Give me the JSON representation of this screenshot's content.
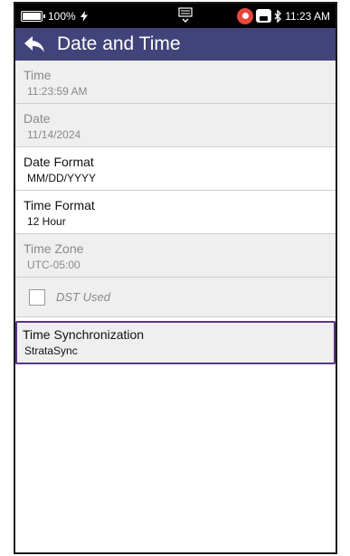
{
  "status_bar": {
    "battery_percent": "100%",
    "time": "11:23 AM",
    "icons": [
      "battery-icon",
      "charging-icon",
      "keyboard-icon",
      "location-pin-icon",
      "cloud-icon",
      "bluetooth-icon"
    ]
  },
  "header": {
    "title": "Date and Time",
    "back_icon": "back-arrow-icon",
    "color": "#42437a"
  },
  "settings": [
    {
      "label": "Time",
      "value": "11:23:59 AM",
      "enabled": false
    },
    {
      "label": "Date",
      "value": "11/14/2024",
      "enabled": false
    },
    {
      "label": "Date Format",
      "value": "MM/DD/YYYY",
      "enabled": true
    },
    {
      "label": "Time Format",
      "value": "12 Hour",
      "enabled": true
    },
    {
      "label": "Time Zone",
      "value": "UTC-05:00",
      "enabled": false
    }
  ],
  "dst": {
    "label": "DST Used",
    "checked": false,
    "enabled": false
  },
  "time_sync": {
    "label": "Time Synchronization",
    "value": "StrataSync",
    "selected": true,
    "highlight_color": "#5b3587"
  }
}
